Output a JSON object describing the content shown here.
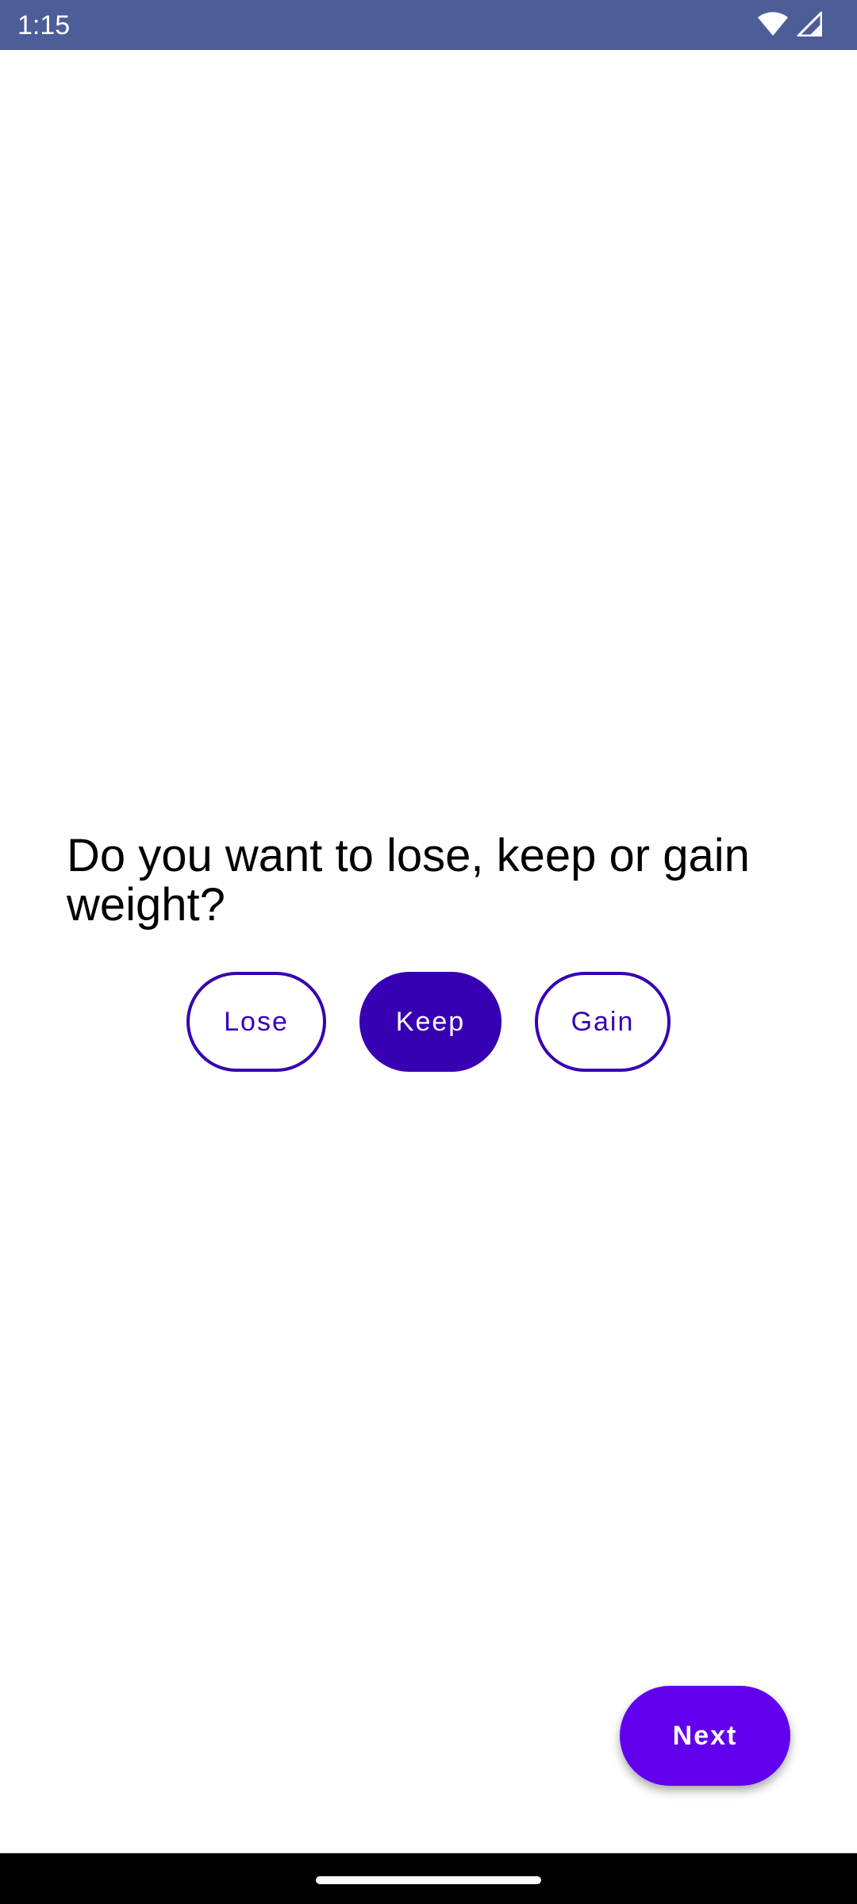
{
  "status_bar": {
    "time": "1:15",
    "background_color": "#4C5D97",
    "icons": [
      "wifi-icon",
      "cellular-signal-icon"
    ]
  },
  "question": {
    "text": "Do you want to lose, keep or gain weight?"
  },
  "choices": [
    {
      "label": "Lose",
      "selected": false
    },
    {
      "label": "Keep",
      "selected": true
    },
    {
      "label": "Gain",
      "selected": false
    }
  ],
  "next_button": {
    "label": "Next"
  },
  "colors": {
    "accent_selected": "#3700B3",
    "primary_button": "#6200EE",
    "background": "#FFFFFF",
    "nav_bar": "#000000"
  }
}
